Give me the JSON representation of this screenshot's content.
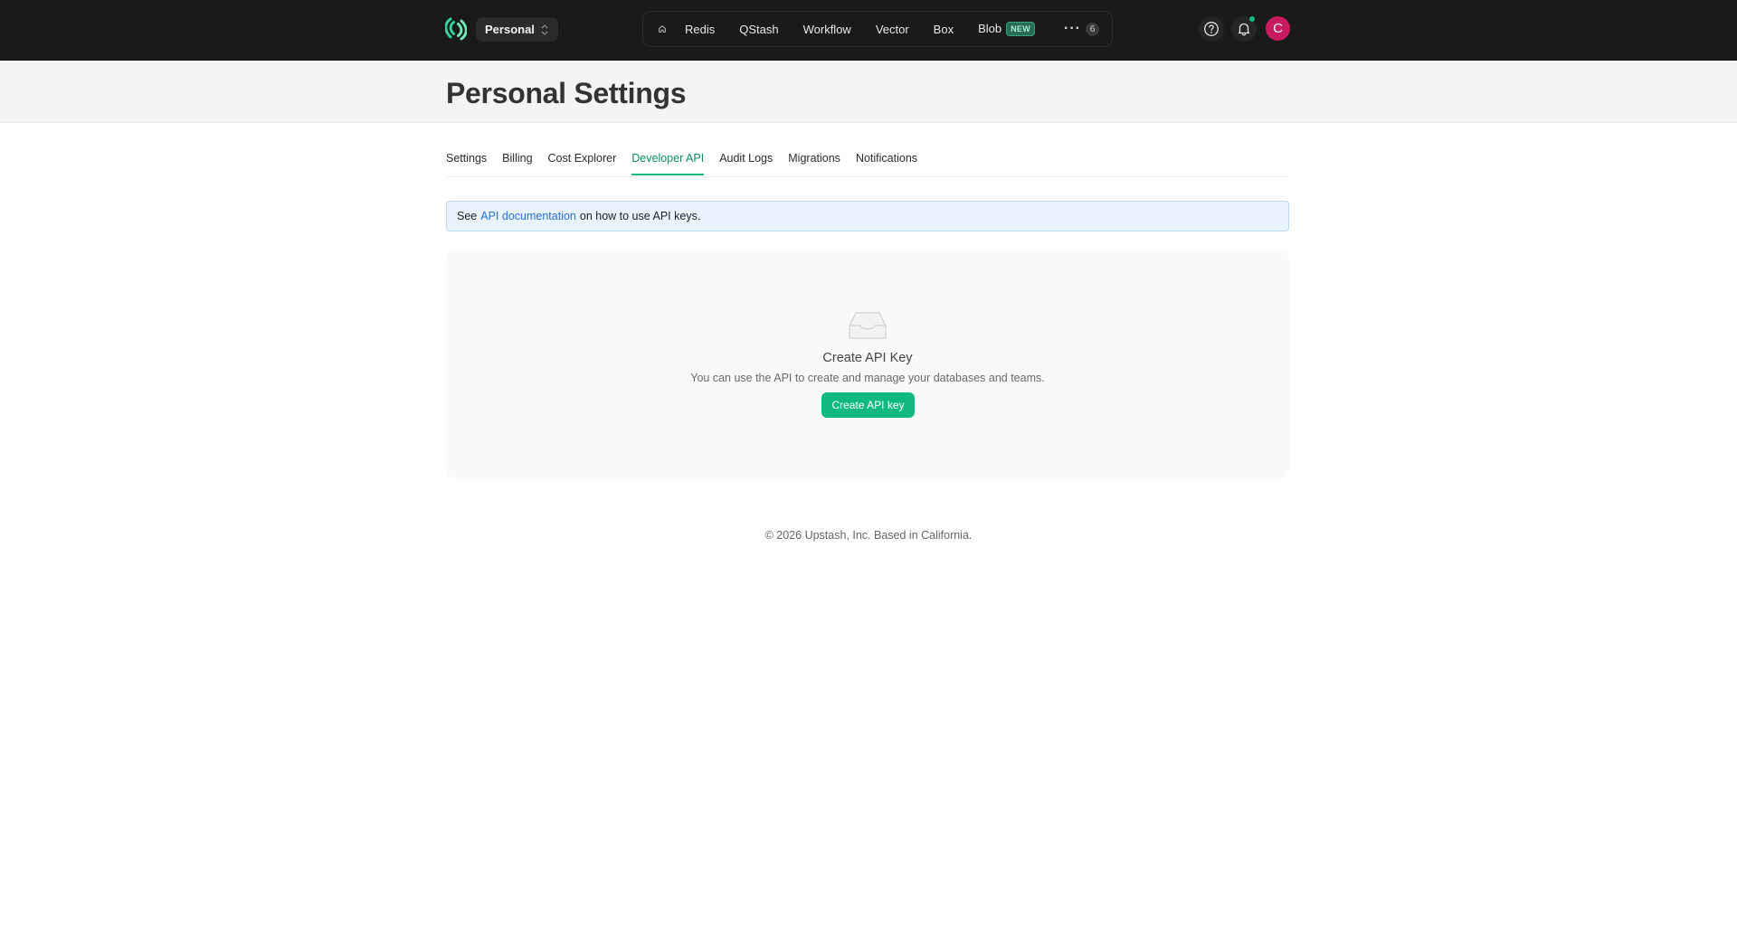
{
  "topbar": {
    "workspace": "Personal",
    "nav": [
      {
        "label": "Redis"
      },
      {
        "label": "QStash"
      },
      {
        "label": "Workflow"
      },
      {
        "label": "Vector"
      },
      {
        "label": "Box"
      },
      {
        "label": "Blob",
        "badge": "NEW"
      }
    ],
    "more_count": "6",
    "avatar_letter": "C",
    "avatar_color": "#c81b5f",
    "accent": "#10b981",
    "icons": [
      "upstash-logo-icon",
      "chevron-updown-icon",
      "home-icon",
      "more-dots-icon",
      "help-icon",
      "bell-icon"
    ]
  },
  "page": {
    "title": "Personal Settings"
  },
  "tabs": [
    {
      "label": "Settings"
    },
    {
      "label": "Billing"
    },
    {
      "label": "Cost Explorer"
    },
    {
      "label": "Developer API",
      "active": true
    },
    {
      "label": "Audit Logs"
    },
    {
      "label": "Migrations"
    },
    {
      "label": "Notifications"
    }
  ],
  "info": {
    "prefix": "See",
    "link": "API documentation",
    "suffix": "on how to use API keys."
  },
  "empty_state": {
    "icon": "inbox-icon",
    "title": "Create API Key",
    "subtitle": "You can use the API to create and manage your databases and teams.",
    "button": "Create API key"
  },
  "footer": {
    "text": "© 2026 Upstash, Inc. Based in California."
  }
}
